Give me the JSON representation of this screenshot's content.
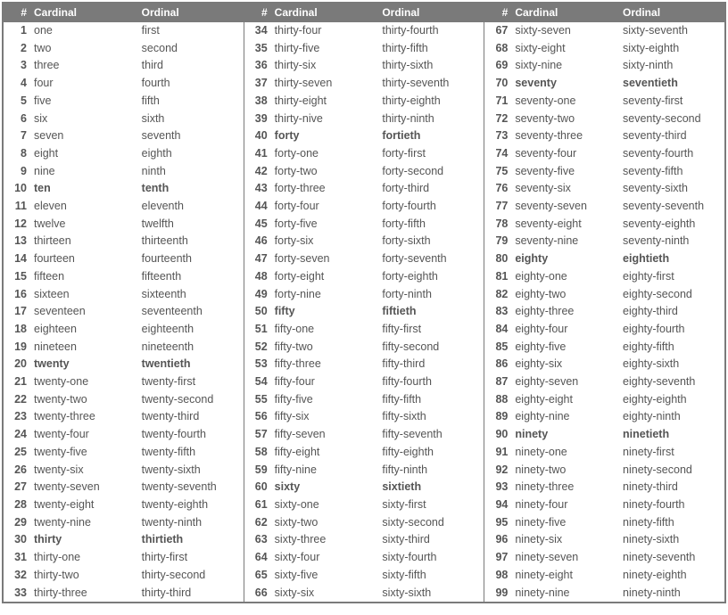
{
  "headers": {
    "num": "#",
    "cardinal": "Cardinal",
    "ordinal": "Ordinal"
  },
  "columns": [
    [
      {
        "n": 1,
        "c": "one",
        "o": "first",
        "b": false
      },
      {
        "n": 2,
        "c": "two",
        "o": "second",
        "b": false
      },
      {
        "n": 3,
        "c": "three",
        "o": "third",
        "b": false
      },
      {
        "n": 4,
        "c": "four",
        "o": "fourth",
        "b": false
      },
      {
        "n": 5,
        "c": "five",
        "o": "fifth",
        "b": false
      },
      {
        "n": 6,
        "c": "six",
        "o": "sixth",
        "b": false
      },
      {
        "n": 7,
        "c": "seven",
        "o": "seventh",
        "b": false
      },
      {
        "n": 8,
        "c": "eight",
        "o": "eighth",
        "b": false
      },
      {
        "n": 9,
        "c": "nine",
        "o": "ninth",
        "b": false
      },
      {
        "n": 10,
        "c": "ten",
        "o": "tenth",
        "b": true
      },
      {
        "n": 11,
        "c": "eleven",
        "o": "eleventh",
        "b": false
      },
      {
        "n": 12,
        "c": "twelve",
        "o": "twelfth",
        "b": false
      },
      {
        "n": 13,
        "c": "thirteen",
        "o": "thirteenth",
        "b": false
      },
      {
        "n": 14,
        "c": "fourteen",
        "o": "fourteenth",
        "b": false
      },
      {
        "n": 15,
        "c": "fifteen",
        "o": "fifteenth",
        "b": false
      },
      {
        "n": 16,
        "c": "sixteen",
        "o": "sixteenth",
        "b": false
      },
      {
        "n": 17,
        "c": "seventeen",
        "o": "seventeenth",
        "b": false
      },
      {
        "n": 18,
        "c": "eighteen",
        "o": "eighteenth",
        "b": false
      },
      {
        "n": 19,
        "c": "nineteen",
        "o": "nineteenth",
        "b": false
      },
      {
        "n": 20,
        "c": "twenty",
        "o": "twentieth",
        "b": true
      },
      {
        "n": 21,
        "c": "twenty-one",
        "o": "twenty-first",
        "b": false
      },
      {
        "n": 22,
        "c": "twenty-two",
        "o": "twenty-second",
        "b": false
      },
      {
        "n": 23,
        "c": "twenty-three",
        "o": "twenty-third",
        "b": false
      },
      {
        "n": 24,
        "c": "twenty-four",
        "o": "twenty-fourth",
        "b": false
      },
      {
        "n": 25,
        "c": "twenty-five",
        "o": "twenty-fifth",
        "b": false
      },
      {
        "n": 26,
        "c": "twenty-six",
        "o": "twenty-sixth",
        "b": false
      },
      {
        "n": 27,
        "c": "twenty-seven",
        "o": "twenty-seventh",
        "b": false
      },
      {
        "n": 28,
        "c": "twenty-eight",
        "o": "twenty-eighth",
        "b": false
      },
      {
        "n": 29,
        "c": "twenty-nine",
        "o": "twenty-ninth",
        "b": false
      },
      {
        "n": 30,
        "c": "thirty",
        "o": "thirtieth",
        "b": true
      },
      {
        "n": 31,
        "c": "thirty-one",
        "o": "thirty-first",
        "b": false
      },
      {
        "n": 32,
        "c": "thirty-two",
        "o": "thirty-second",
        "b": false
      },
      {
        "n": 33,
        "c": "thirty-three",
        "o": "thirty-third",
        "b": false
      }
    ],
    [
      {
        "n": 34,
        "c": "thirty-four",
        "o": "thirty-fourth",
        "b": false
      },
      {
        "n": 35,
        "c": "thirty-five",
        "o": "thirty-fifth",
        "b": false
      },
      {
        "n": 36,
        "c": "thirty-six",
        "o": "thirty-sixth",
        "b": false
      },
      {
        "n": 37,
        "c": "thirty-seven",
        "o": "thirty-seventh",
        "b": false
      },
      {
        "n": 38,
        "c": "thirty-eight",
        "o": "thirty-eighth",
        "b": false
      },
      {
        "n": 39,
        "c": "thirty-nive",
        "o": "thirty-ninth",
        "b": false
      },
      {
        "n": 40,
        "c": "forty",
        "o": "fortieth",
        "b": true
      },
      {
        "n": 41,
        "c": "forty-one",
        "o": "forty-first",
        "b": false
      },
      {
        "n": 42,
        "c": "forty-two",
        "o": "forty-second",
        "b": false
      },
      {
        "n": 43,
        "c": "forty-three",
        "o": "forty-third",
        "b": false
      },
      {
        "n": 44,
        "c": "forty-four",
        "o": "forty-fourth",
        "b": false
      },
      {
        "n": 45,
        "c": "forty-five",
        "o": "forty-fifth",
        "b": false
      },
      {
        "n": 46,
        "c": "forty-six",
        "o": "forty-sixth",
        "b": false
      },
      {
        "n": 47,
        "c": "forty-seven",
        "o": "forty-seventh",
        "b": false
      },
      {
        "n": 48,
        "c": "forty-eight",
        "o": "forty-eighth",
        "b": false
      },
      {
        "n": 49,
        "c": "forty-nine",
        "o": "forty-ninth",
        "b": false
      },
      {
        "n": 50,
        "c": "fifty",
        "o": "fiftieth",
        "b": true
      },
      {
        "n": 51,
        "c": "fifty-one",
        "o": "fifty-first",
        "b": false
      },
      {
        "n": 52,
        "c": "fifty-two",
        "o": "fifty-second",
        "b": false
      },
      {
        "n": 53,
        "c": "fifty-three",
        "o": "fifty-third",
        "b": false
      },
      {
        "n": 54,
        "c": "fifty-four",
        "o": "fifty-fourth",
        "b": false
      },
      {
        "n": 55,
        "c": "fifty-five",
        "o": "fifty-fifth",
        "b": false
      },
      {
        "n": 56,
        "c": "fifty-six",
        "o": "fifty-sixth",
        "b": false
      },
      {
        "n": 57,
        "c": "fifty-seven",
        "o": "fifty-seventh",
        "b": false
      },
      {
        "n": 58,
        "c": "fifty-eight",
        "o": "fifty-eighth",
        "b": false
      },
      {
        "n": 59,
        "c": "fifty-nine",
        "o": "fifty-ninth",
        "b": false
      },
      {
        "n": 60,
        "c": "sixty",
        "o": "sixtieth",
        "b": true
      },
      {
        "n": 61,
        "c": "sixty-one",
        "o": "sixty-first",
        "b": false
      },
      {
        "n": 62,
        "c": "sixty-two",
        "o": "sixty-second",
        "b": false
      },
      {
        "n": 63,
        "c": "sixty-three",
        "o": "sixty-third",
        "b": false
      },
      {
        "n": 64,
        "c": "sixty-four",
        "o": "sixty-fourth",
        "b": false
      },
      {
        "n": 65,
        "c": "sixty-five",
        "o": "sixty-fifth",
        "b": false
      },
      {
        "n": 66,
        "c": "sixty-six",
        "o": "sixty-sixth",
        "b": false
      }
    ],
    [
      {
        "n": 67,
        "c": "sixty-seven",
        "o": "sixty-seventh",
        "b": false
      },
      {
        "n": 68,
        "c": "sixty-eight",
        "o": "sixty-eighth",
        "b": false
      },
      {
        "n": 69,
        "c": "sixty-nine",
        "o": "sixty-ninth",
        "b": false
      },
      {
        "n": 70,
        "c": "seventy",
        "o": "seventieth",
        "b": true
      },
      {
        "n": 71,
        "c": "seventy-one",
        "o": "seventy-first",
        "b": false
      },
      {
        "n": 72,
        "c": "seventy-two",
        "o": "seventy-second",
        "b": false
      },
      {
        "n": 73,
        "c": "seventy-three",
        "o": "seventy-third",
        "b": false
      },
      {
        "n": 74,
        "c": "seventy-four",
        "o": "seventy-fourth",
        "b": false
      },
      {
        "n": 75,
        "c": "seventy-five",
        "o": "seventy-fifth",
        "b": false
      },
      {
        "n": 76,
        "c": "seventy-six",
        "o": "seventy-sixth",
        "b": false
      },
      {
        "n": 77,
        "c": "seventy-seven",
        "o": "seventy-seventh",
        "b": false
      },
      {
        "n": 78,
        "c": "seventy-eight",
        "o": "seventy-eighth",
        "b": false
      },
      {
        "n": 79,
        "c": "seventy-nine",
        "o": "seventy-ninth",
        "b": false
      },
      {
        "n": 80,
        "c": "eighty",
        "o": "eightieth",
        "b": true
      },
      {
        "n": 81,
        "c": "eighty-one",
        "o": "eighty-first",
        "b": false
      },
      {
        "n": 82,
        "c": "eighty-two",
        "o": "eighty-second",
        "b": false
      },
      {
        "n": 83,
        "c": "eighty-three",
        "o": "eighty-third",
        "b": false
      },
      {
        "n": 84,
        "c": "eighty-four",
        "o": "eighty-fourth",
        "b": false
      },
      {
        "n": 85,
        "c": "eighty-five",
        "o": "eighty-fifth",
        "b": false
      },
      {
        "n": 86,
        "c": "eighty-six",
        "o": "eighty-sixth",
        "b": false
      },
      {
        "n": 87,
        "c": "eighty-seven",
        "o": "eighty-seventh",
        "b": false
      },
      {
        "n": 88,
        "c": "eighty-eight",
        "o": "eighty-eighth",
        "b": false
      },
      {
        "n": 89,
        "c": "eighty-nine",
        "o": "eighty-ninth",
        "b": false
      },
      {
        "n": 90,
        "c": "ninety",
        "o": "ninetieth",
        "b": true
      },
      {
        "n": 91,
        "c": "ninety-one",
        "o": "ninety-first",
        "b": false
      },
      {
        "n": 92,
        "c": "ninety-two",
        "o": "ninety-second",
        "b": false
      },
      {
        "n": 93,
        "c": "ninety-three",
        "o": "ninety-third",
        "b": false
      },
      {
        "n": 94,
        "c": "ninety-four",
        "o": "ninety-fourth",
        "b": false
      },
      {
        "n": 95,
        "c": "ninety-five",
        "o": "ninety-fifth",
        "b": false
      },
      {
        "n": 96,
        "c": "ninety-six",
        "o": "ninety-sixth",
        "b": false
      },
      {
        "n": 97,
        "c": "ninety-seven",
        "o": "ninety-seventh",
        "b": false
      },
      {
        "n": 98,
        "c": "ninety-eight",
        "o": "ninety-eighth",
        "b": false
      },
      {
        "n": 99,
        "c": "ninety-nine",
        "o": "ninety-ninth",
        "b": false
      }
    ]
  ]
}
